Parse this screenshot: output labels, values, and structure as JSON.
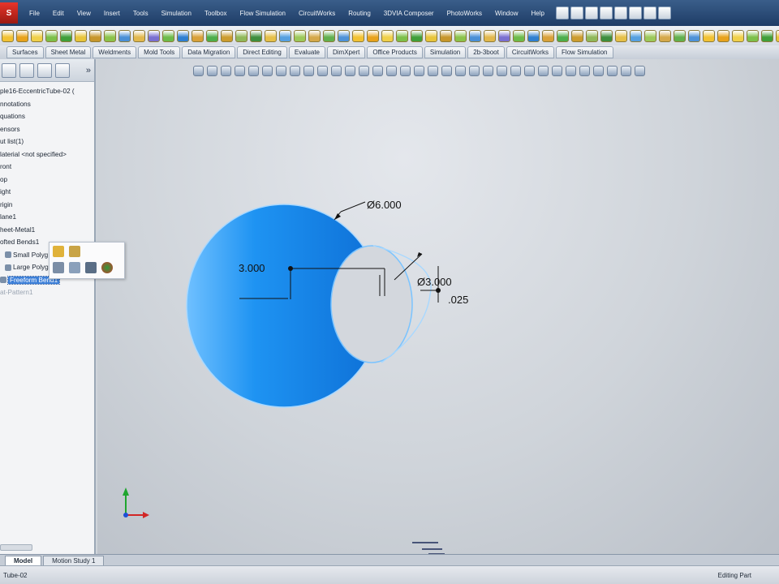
{
  "app": {
    "logo": "S"
  },
  "menus": [
    "File",
    "Edit",
    "View",
    "Insert",
    "Tools",
    "Simulation",
    "Toolbox",
    "Flow Simulation",
    "CircuitWorks",
    "Routing",
    "3DVIA Composer",
    "PhotoWorks",
    "Window",
    "Help"
  ],
  "command_tabs": [
    "Surfaces",
    "Sheet Metal",
    "Weldments",
    "Mold Tools",
    "Data Migration",
    "Direct Editing",
    "Evaluate",
    "DimXpert",
    "Office Products",
    "Simulation",
    "2b-3boot",
    "CircuitWorks",
    "Flow Simulation"
  ],
  "feature_tree": {
    "expand_glyph": "»",
    "items": [
      {
        "label": "ple16-EccentricTube-02 (",
        "state": "normal",
        "indent": false
      },
      {
        "label": "nnotations",
        "state": "normal",
        "indent": false
      },
      {
        "label": "quations",
        "state": "normal",
        "indent": false
      },
      {
        "label": "ensors",
        "state": "normal",
        "indent": false
      },
      {
        "label": "ut list(1)",
        "state": "normal",
        "indent": false
      },
      {
        "label": "laterial <not specified>",
        "state": "normal",
        "indent": false
      },
      {
        "label": "ront",
        "state": "normal",
        "indent": false
      },
      {
        "label": "op",
        "state": "normal",
        "indent": false
      },
      {
        "label": "ight",
        "state": "normal",
        "indent": false
      },
      {
        "label": "rigin",
        "state": "normal",
        "indent": false
      },
      {
        "label": "lane1",
        "state": "normal",
        "indent": false
      },
      {
        "label": "heet-Metal1",
        "state": "normal",
        "indent": false
      },
      {
        "label": "ofted Bends1",
        "state": "normal",
        "indent": false
      },
      {
        "label": "Small Polyg",
        "state": "normal",
        "indent": true
      },
      {
        "label": "Large Polyg",
        "state": "normal",
        "indent": true
      },
      {
        "label": "Freeform Bend1",
        "state": "selected",
        "indent": false
      },
      {
        "label": "at-Pattern1",
        "state": "faded",
        "indent": false
      }
    ]
  },
  "dimensions": {
    "large_diameter": "Ø6.000",
    "offset": "3.000",
    "small_diameter": "Ø3.000",
    "thickness": ".025"
  },
  "colors": {
    "model_blue": "#1a8fee",
    "model_edge": "#9fd4ff",
    "selection": "#3c7fd8"
  },
  "bottom_tabs": [
    "Model",
    "Motion Study 1"
  ],
  "status": {
    "left": "Tube-02",
    "right": "Editing Part"
  }
}
